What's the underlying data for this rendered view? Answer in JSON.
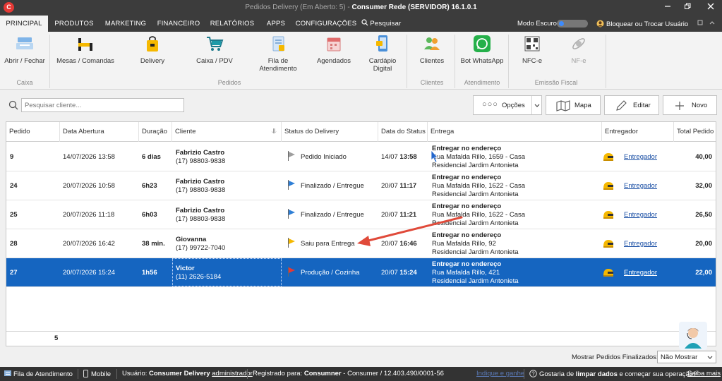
{
  "window": {
    "title_dim": "Pedidos Delivery (Em Aberto: 5) - ",
    "title_strong": "Consumer Rede (SERVIDOR) 16.1.0.1",
    "logo": "C"
  },
  "menu": {
    "tabs": [
      "PRINCIPAL",
      "PRODUTOS",
      "MARKETING",
      "FINANCEIRO",
      "RELATÓRIOS",
      "APPS",
      "CONFIGURAÇÕES",
      "Pesquisar"
    ],
    "active": "PRINCIPAL",
    "dark_mode_label": "Modo Escuro",
    "lock_label": "Bloquear ou Trocar Usuário"
  },
  "ribbon": {
    "buttons": {
      "abrir_fechar": "Abrir / Fechar",
      "mesas": "Mesas / Comandas",
      "delivery": "Delivery",
      "caixa_pdv": "Caixa / PDV",
      "fila_1": "Fila de",
      "fila_2": "Atendimento",
      "agendados": "Agendados",
      "cardapio_1": "Cardápio",
      "cardapio_2": "Digital",
      "clientes": "Clientes",
      "bot_whatsapp": "Bot WhatsApp",
      "nfce": "NFC-e",
      "nfe": "NF-e"
    },
    "groups": {
      "caixa": "Caixa",
      "pedidos": "Pedidos",
      "clientes": "Clientes",
      "atendimento": "Atendimento",
      "emissao": "Emissão Fiscal"
    }
  },
  "toolbar": {
    "search_placeholder": "Pesquisar cliente...",
    "options_label": "Opções",
    "map_label": "Mapa",
    "edit_label": "Editar",
    "new_label": "Novo"
  },
  "grid": {
    "columns": [
      "Pedido",
      "Data Abertura",
      "Duração",
      "Cliente",
      "Status do Delivery",
      "Data do Status",
      "Entrega",
      "Entregador",
      "Total Pedido"
    ],
    "rows": [
      {
        "pedido": "9",
        "abertura": "14/07/2026 13:58",
        "duracao": "6 dias",
        "cliente": "Fabrizio Castro",
        "telefone": "(17) 98803-9838",
        "status": "Pedido Iniciado",
        "status_color": "#9e9e9e",
        "status_data": "14/07",
        "status_hora": "13:58",
        "entrega_tipo": "Entregar no endereço",
        "endereco": "Rua Mafalda Rillo, 1659 - Casa",
        "bairro": "Residencial Jardim Antonieta",
        "entregador": "Entregador",
        "total": "40,00"
      },
      {
        "pedido": "24",
        "abertura": "20/07/2026 10:58",
        "duracao": "6h23",
        "cliente": "Fabrizio Castro",
        "telefone": "(17) 98803-9838",
        "status": "Finalizado / Entregue",
        "status_color": "#2f7fd6",
        "status_data": "20/07",
        "status_hora": "11:17",
        "entrega_tipo": "Entregar no endereço",
        "endereco": "Rua Mafalda Rillo, 1622 - Casa",
        "bairro": "Residencial Jardim Antonieta",
        "entregador": "Entregador",
        "total": "32,00"
      },
      {
        "pedido": "25",
        "abertura": "20/07/2026 11:18",
        "duracao": "6h03",
        "cliente": "Fabrizio Castro",
        "telefone": "(17) 98803-9838",
        "status": "Finalizado / Entregue",
        "status_color": "#2f7fd6",
        "status_data": "20/07",
        "status_hora": "11:21",
        "entrega_tipo": "Entregar no endereço",
        "endereco": "Rua Mafalda Rillo, 1622 - Casa",
        "bairro": "Residencial Jardim Antonieta",
        "entregador": "Entregador",
        "total": "26,50"
      },
      {
        "pedido": "28",
        "abertura": "20/07/2026 16:42",
        "duracao": "38 min.",
        "cliente": "Giovanna",
        "telefone": "(17) 99722-7040",
        "status": "Saiu para Entrega",
        "status_color": "#f5b800",
        "status_data": "20/07",
        "status_hora": "16:46",
        "entrega_tipo": "Entregar no endereço",
        "endereco": "Rua Mafalda Rillo, 92",
        "bairro": "Residencial Jardim Antonieta",
        "entregador": "Entregador",
        "total": "20,00"
      },
      {
        "pedido": "27",
        "abertura": "20/07/2026 15:24",
        "duracao": "1h56",
        "cliente": "Victor",
        "telefone": "(11) 2626-5184",
        "status": "Produção / Cozinha",
        "status_color": "#e53935",
        "status_data": "20/07",
        "status_hora": "15:24",
        "entrega_tipo": "Entregar no endereço",
        "endereco": "Rua Mafalda Rillo, 421",
        "bairro": "Residencial Jardim Antonieta",
        "entregador": "Entregador",
        "total": "22,00"
      }
    ],
    "footer_count": "5"
  },
  "bottom": {
    "show_finalized_label": "Mostrar Pedidos Finalizados:",
    "show_finalized_value": "Não Mostrar"
  },
  "statusbar": {
    "fila": "Fila de Atendimento",
    "mobile": "Mobile",
    "usuario_label": "Usuário:",
    "usuario_name": "Consumer Delivery",
    "usuario_role": "administrador",
    "registrado_label": "Registrado para:",
    "registrado_name": "Consumner",
    "registrado_rest": " - Consumer / 12.403.490/0001-56",
    "indique": "Indique e ganhe",
    "limpar_1": "Gostaria de ",
    "limpar_bold": "limpar dados",
    "limpar_2": " e começar sua operação?",
    "saiba": "Saiba mais"
  }
}
